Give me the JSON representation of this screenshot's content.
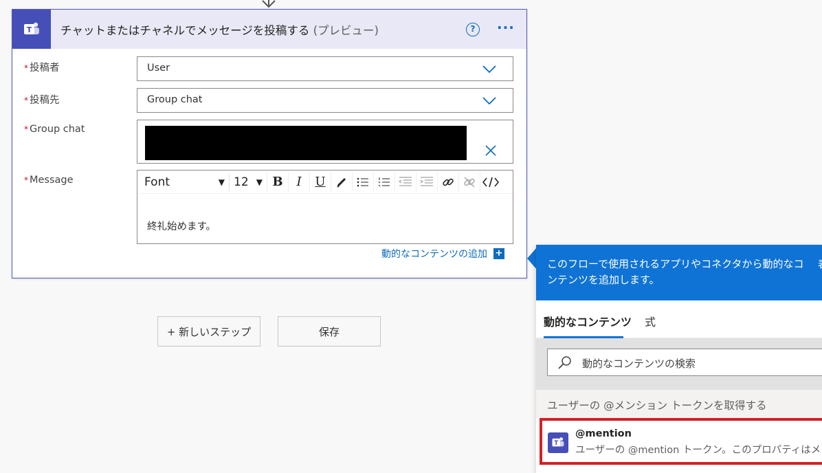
{
  "card": {
    "title": "チャットまたはチャネルでメッセージを投稿する",
    "title_suffix": "(プレビュー)",
    "help_icon": "?",
    "more_icon": "···",
    "fields": [
      {
        "label": "投稿者",
        "value": "User"
      },
      {
        "label": "投稿先",
        "value": "Group chat"
      },
      {
        "label": "Group chat",
        "value": ""
      },
      {
        "label": "Message",
        "value": "終礼始めます。"
      }
    ],
    "required_mark": "*",
    "toolbar": {
      "font": "Font",
      "size": "12"
    },
    "dynamic_link": "動的なコンテンツの追加",
    "dynamic_plus": "+"
  },
  "buttons": {
    "new_step": "+ 新しいステップ",
    "save": "保存"
  },
  "panel": {
    "header": "このフローで使用されるアプリやコネクタから動的なコンテンツを追加します。",
    "header_cut": "表",
    "tab_dynamic": "動的なコンテンツ",
    "tab_expression": "式",
    "search_placeholder": "動的なコンテンツの検索",
    "section_label": "ユーザーの @メンション トークンを取得する",
    "item_title": "@mention",
    "item_desc": "ユーザーの @mention トークン。このプロパティはメ"
  },
  "colors": {
    "accent": "#0f6cbd",
    "teams": "#464eb8",
    "highlight": "#d31f25"
  }
}
